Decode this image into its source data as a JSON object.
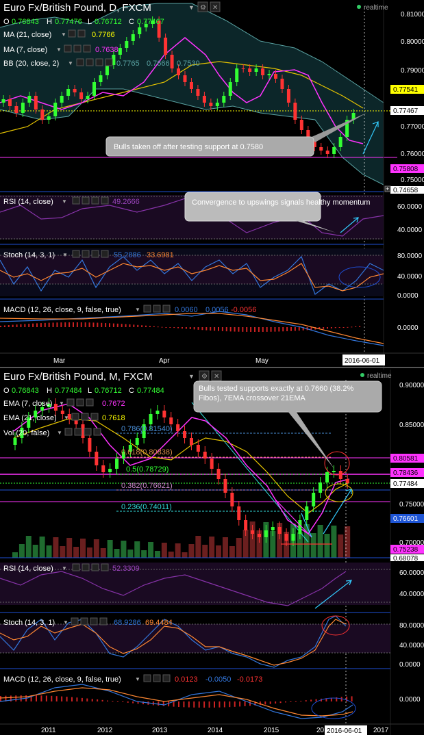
{
  "top": {
    "title": "Euro Fx/British Pound, D, FXCM",
    "realtime": "realtime",
    "ohlc": {
      "o_label": "O",
      "o": "0.76843",
      "h_label": "H",
      "h": "0.77476",
      "l_label": "L",
      "l": "0.76712",
      "c_label": "C",
      "c": "0.77467"
    },
    "legend": [
      {
        "label": "MA (21, close)",
        "value": "0.7766",
        "color": "#ffff00"
      },
      {
        "label": "MA (7, close)",
        "value": "0.7638",
        "color": "#ff33ff"
      },
      {
        "label": "BB (20, close, 2)",
        "values": [
          "0.7765",
          "0.7666",
          "0.7530"
        ],
        "color": "#5aa3a3"
      }
    ],
    "price_axis": [
      "0.81000",
      "0.80000",
      "0.79000",
      "0.77000",
      "0.76000",
      "0.75000"
    ],
    "price_tags": [
      {
        "text": "0.77541",
        "bg": "#ffff00",
        "fg": "#000000"
      },
      {
        "text": "0.77467",
        "bg": "#ffffff",
        "fg": "#000000"
      },
      {
        "text": "0.75808",
        "bg": "#ff33ff",
        "fg": "#000000"
      },
      {
        "text": "0.74658",
        "bg": "#ffffff",
        "fg": "#000000"
      }
    ],
    "annotations": [
      "Bulls taken off after testing support at 0.7580",
      "Convergence to upswings signals healthy momentum"
    ],
    "rsi": {
      "label": "RSI (14, close)",
      "value": "49.2666",
      "axis": [
        "60.0000",
        "40.0000"
      ]
    },
    "stoch": {
      "label": "Stoch (14, 3, 1)",
      "values": [
        "55.2886",
        "33.6981"
      ],
      "axis": [
        "80.0000",
        "40.0000",
        "0.0000"
      ]
    },
    "macd": {
      "label": "MACD (12, 26, close, 9, false, true)",
      "values": [
        "0.0060",
        "0.0056",
        "-0.0056"
      ],
      "axis": [
        "0.0000"
      ]
    },
    "time_axis": [
      "Mar",
      "Apr",
      "May"
    ],
    "date_badge": "2016-06-01"
  },
  "bottom": {
    "title": "Euro Fx/British Pound, M, FXCM",
    "realtime": "realtime",
    "ohlc": {
      "o_label": "O",
      "o": "0.76843",
      "h_label": "H",
      "h": "0.77484",
      "l_label": "L",
      "l": "0.76712",
      "c_label": "C",
      "c": "0.77484"
    },
    "legend": [
      {
        "label": "EMA (7, close)",
        "value": "0.7672",
        "color": "#ff33ff"
      },
      {
        "label": "EMA (21, close)",
        "value": "0.7618",
        "color": "#ffff00"
      },
      {
        "label": "Vol (20, false)",
        "value": "",
        "color": "#ffffff"
      }
    ],
    "fibs": [
      {
        "text": "0.786(0.81540)",
        "color": "#4a90d9"
      },
      {
        "text": "0.618(0.80838)",
        "color": "#d98c4a"
      },
      {
        "text": "0.5(0.78729)",
        "color": "#33ff33"
      },
      {
        "text": "0.382(0.76621)",
        "color": "#cc88cc"
      },
      {
        "text": "0.236(0.74011)",
        "color": "#33dddd"
      }
    ],
    "price_axis": [
      "0.90000",
      "0.85000",
      "0.75000",
      "0.70000"
    ],
    "price_tags": [
      {
        "text": "0.80581",
        "bg": "#ff33ff",
        "fg": "#000000"
      },
      {
        "text": "0.78436",
        "bg": "#ff33ff",
        "fg": "#000000"
      },
      {
        "text": "0.77484",
        "bg": "#ffffff",
        "fg": "#000000"
      },
      {
        "text": "0.76601",
        "bg": "#1e55d6",
        "fg": "#ffffff"
      },
      {
        "text": "0.75238",
        "bg": "#ff33ff",
        "fg": "#000000"
      },
      {
        "text": "0.68078",
        "bg": "#ffffff",
        "fg": "#000000"
      }
    ],
    "annotation": "Bulls tested supports exactly at 0.7660 (38.2% Fibos), 7EMA crossover 21EMA",
    "rsi": {
      "label": "RSI (14, close)",
      "value": "52.3309",
      "axis": [
        "60.0000",
        "40.0000"
      ]
    },
    "stoch": {
      "label": "Stoch (14, 3, 1)",
      "values": [
        "68.9286",
        "69.4484"
      ],
      "axis": [
        "80.0000",
        "40.0000",
        "0.0000"
      ]
    },
    "macd": {
      "label": "MACD (12, 26, close, 9, false, true)",
      "values": [
        "0.0123",
        "-0.0050",
        "-0.0173"
      ],
      "axis": [
        "0.0000"
      ]
    },
    "time_axis": [
      "2011",
      "2012",
      "2013",
      "2014",
      "2015",
      "20",
      "2017"
    ],
    "date_badge": "2016-06-01"
  },
  "colors": {
    "bull": "#33ff33",
    "bear": "#ff3333",
    "grid": "#1a1a2a",
    "panel_line": "#1e4fd6",
    "rsi_band": "#2a1030"
  }
}
